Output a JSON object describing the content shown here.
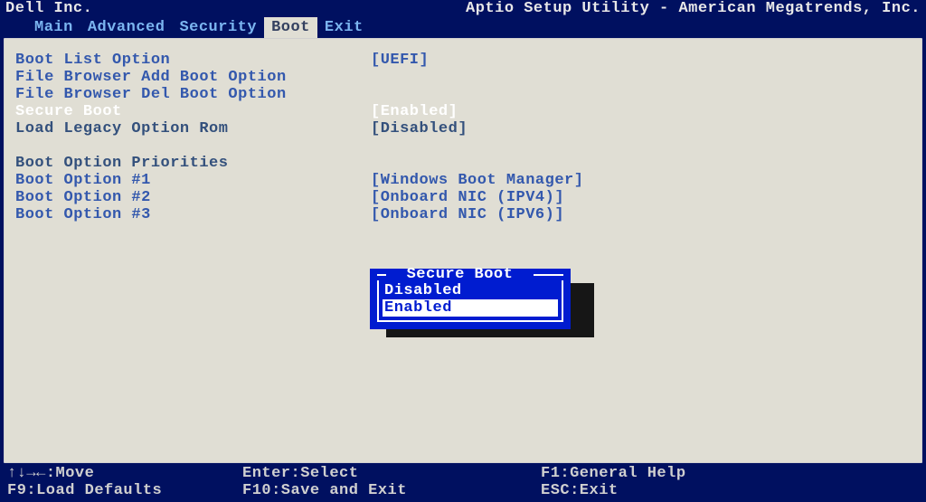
{
  "title": {
    "vendor": "Dell Inc.",
    "utility": "Aptio Setup Utility - American Megatrends, Inc."
  },
  "menu": {
    "items": [
      "Main",
      "Advanced",
      "Security",
      "Boot",
      "Exit"
    ],
    "active_index": 3
  },
  "boot_page": {
    "rows": [
      {
        "label": "Boot List Option",
        "value": "[UEFI]",
        "kind": "link"
      },
      {
        "label": "File Browser Add Boot Option",
        "value": "",
        "kind": "link"
      },
      {
        "label": "File Browser Del Boot Option",
        "value": "",
        "kind": "link"
      },
      {
        "label": "Secure Boot",
        "value": "[Enabled]",
        "kind": "selected"
      },
      {
        "label": "Load Legacy Option Rom",
        "value": "[Disabled]",
        "kind": "static"
      }
    ],
    "priorities_title": "Boot Option Priorities",
    "priorities": [
      {
        "label": "Boot Option #1",
        "value": "[Windows Boot Manager]"
      },
      {
        "label": "Boot Option #2",
        "value": "[Onboard NIC (IPV4)]"
      },
      {
        "label": "Boot Option #3",
        "value": "[Onboard NIC (IPV6)]"
      }
    ]
  },
  "popup": {
    "title": " Secure Boot ",
    "options": [
      "Disabled",
      "Enabled"
    ],
    "selected_index": 1
  },
  "footer": {
    "move_arrows": "↑↓→←",
    "move": ":Move",
    "enter": "Enter:Select",
    "f1": "F1:General Help",
    "f9": "F9:Load Defaults",
    "f10": "F10:Save and Exit",
    "esc": "ESC:Exit"
  }
}
